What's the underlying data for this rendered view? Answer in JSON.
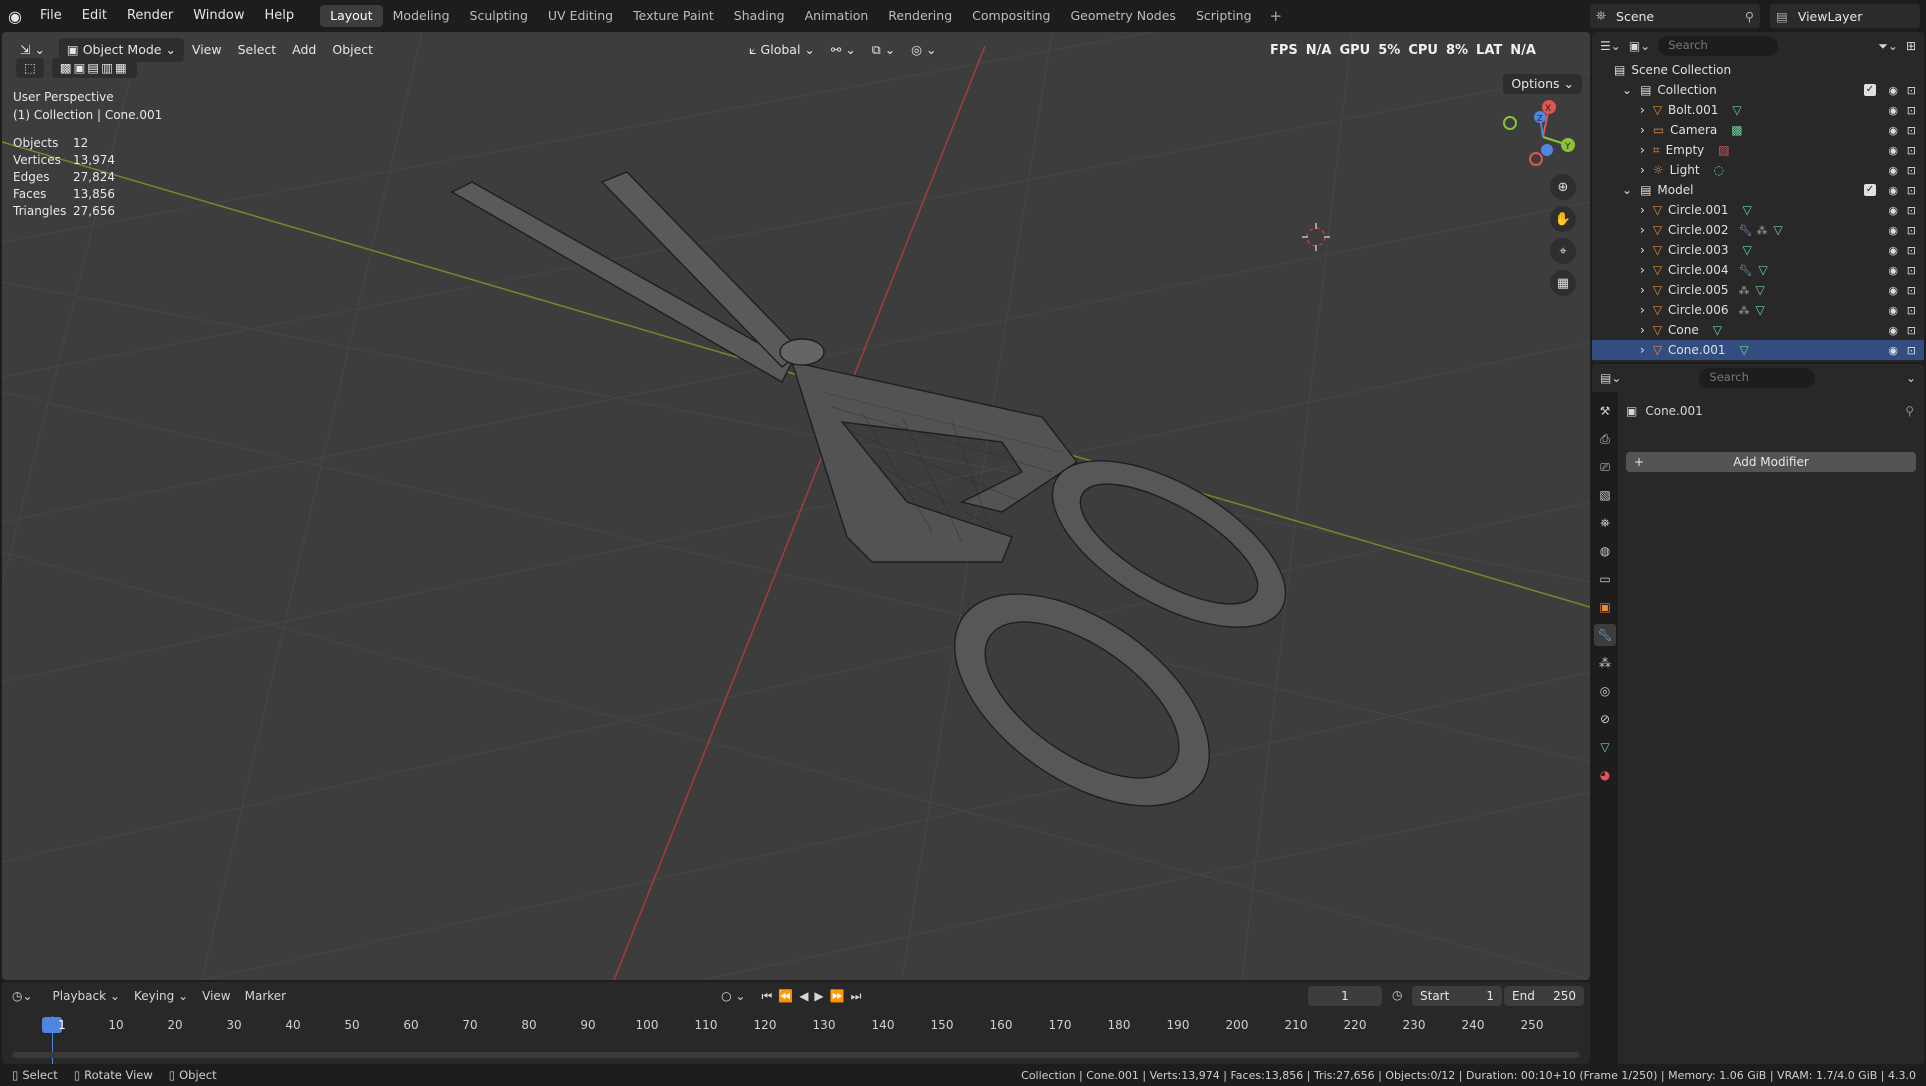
{
  "topbar": {
    "menus": [
      "File",
      "Edit",
      "Render",
      "Window",
      "Help"
    ],
    "workspaces": [
      "Layout",
      "Modeling",
      "Sculpting",
      "UV Editing",
      "Texture Paint",
      "Shading",
      "Animation",
      "Rendering",
      "Compositing",
      "Geometry Nodes",
      "Scripting"
    ],
    "active_workspace": "Layout",
    "scene": "Scene",
    "view_layer": "ViewLayer"
  },
  "viewport": {
    "mode": "Object Mode",
    "menus": [
      "View",
      "Select",
      "Add",
      "Object"
    ],
    "transform_orientation": "Global",
    "options_label": "Options",
    "perf": {
      "fps_label": "FPS",
      "fps": "N/A",
      "gpu_label": "GPU",
      "gpu": "5%",
      "cpu_label": "CPU",
      "cpu": "8%",
      "lat_label": "LAT",
      "lat": "N/A"
    },
    "perspective": "User Perspective",
    "context": "(1) Collection | Cone.001",
    "stats": [
      {
        "label": "Objects",
        "value": "12"
      },
      {
        "label": "Vertices",
        "value": "13,974"
      },
      {
        "label": "Edges",
        "value": "27,824"
      },
      {
        "label": "Faces",
        "value": "13,856"
      },
      {
        "label": "Triangles",
        "value": "27,656"
      }
    ],
    "gizmo": {
      "x": "X",
      "y": "Y",
      "z": "Z"
    }
  },
  "outliner": {
    "search_placeholder": "Search",
    "root": "Scene Collection",
    "collections": [
      {
        "name": "Collection",
        "items": [
          "Bolt.001",
          "Camera",
          "Empty",
          "Light"
        ]
      },
      {
        "name": "Model",
        "items": [
          "Circle.001",
          "Circle.002",
          "Circle.003",
          "Circle.004",
          "Circle.005",
          "Circle.006",
          "Cone",
          "Cone.001"
        ]
      }
    ]
  },
  "properties": {
    "search_placeholder": "Search",
    "object_name": "Cone.001",
    "add_modifier": "Add Modifier"
  },
  "timeline": {
    "menus": [
      "Playback",
      "Keying",
      "View",
      "Marker"
    ],
    "current_frame": "1",
    "start_label": "Start",
    "start": "1",
    "end_label": "End",
    "end": "250",
    "ticks": [
      "1",
      "10",
      "20",
      "30",
      "40",
      "50",
      "60",
      "70",
      "80",
      "90",
      "100",
      "110",
      "120",
      "130",
      "140",
      "150",
      "160",
      "170",
      "180",
      "190",
      "200",
      "210",
      "220",
      "230",
      "240",
      "250"
    ]
  },
  "statusbar": {
    "select": "Select",
    "rotate": "Rotate View",
    "object": "Object",
    "info": "Collection | Cone.001 | Verts:13,974 | Faces:13,856 | Tris:27,656 | Objects:0/12 | Duration: 00:10+10 (Frame 1/250) | Memory: 1.06 GiB | VRAM: 1.7/4.0 GiB | 4.3.0"
  }
}
